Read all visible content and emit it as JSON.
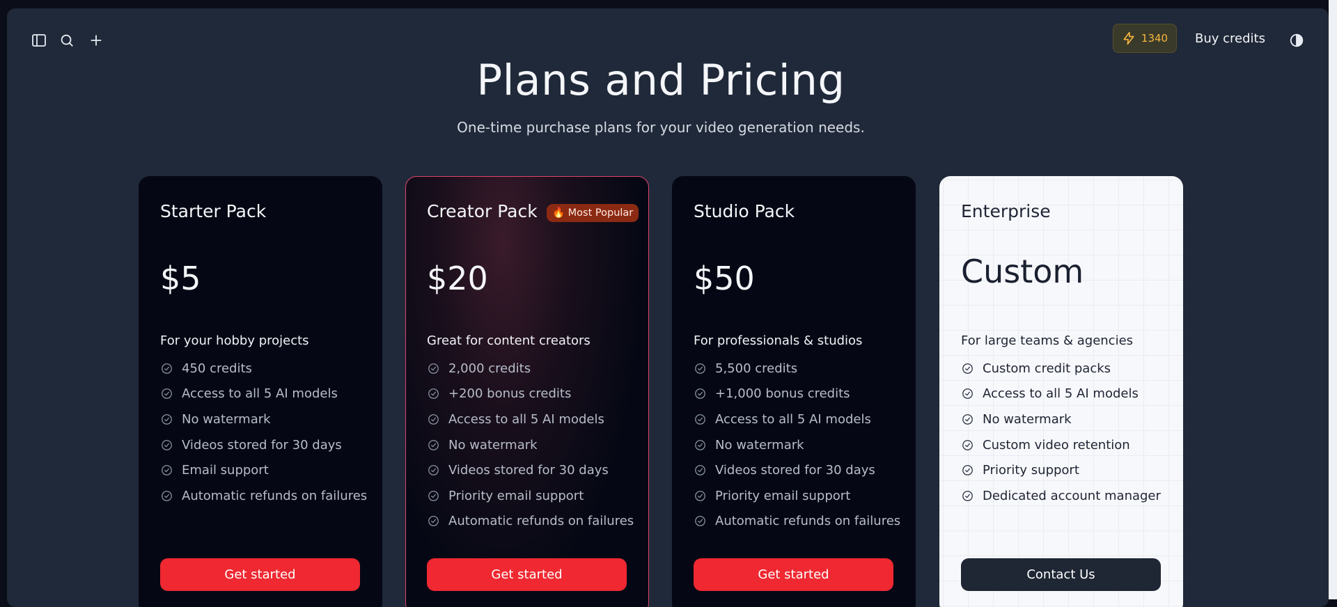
{
  "topbar": {
    "credits": "1340",
    "buy_credits_label": "Buy credits"
  },
  "header": {
    "title": "Plans and Pricing",
    "subtitle": "One-time purchase plans for your video generation needs."
  },
  "plans": [
    {
      "name": "Starter Pack",
      "price": "$5",
      "description": "For your hobby projects",
      "features": [
        "450 credits",
        "Access to all 5 AI models",
        "No watermark",
        "Videos stored for 30 days",
        "Email support",
        "Automatic refunds on failures"
      ],
      "cta": "Get started"
    },
    {
      "name": "Creator Pack",
      "badge": "🔥 Most Popular",
      "price": "$20",
      "description": "Great for content creators",
      "features": [
        "2,000 credits",
        "+200 bonus credits",
        "Access to all 5 AI models",
        "No watermark",
        "Videos stored for 30 days",
        "Priority email support",
        "Automatic refunds on failures"
      ],
      "cta": "Get started"
    },
    {
      "name": "Studio Pack",
      "price": "$50",
      "description": "For professionals & studios",
      "features": [
        "5,500 credits",
        "+1,000 bonus credits",
        "Access to all 5 AI models",
        "No watermark",
        "Videos stored for 30 days",
        "Priority email support",
        "Automatic refunds on failures"
      ],
      "cta": "Get started"
    },
    {
      "name": "Enterprise",
      "price": "Custom",
      "description": "For large teams & agencies",
      "features": [
        "Custom credit packs",
        "Access to all 5 AI models",
        "No watermark",
        "Custom video retention",
        "Priority support",
        "Dedicated account manager"
      ],
      "cta": "Contact Us"
    }
  ],
  "colors": {
    "accent": "#ef2831",
    "credits_text": "#f4b53f",
    "popular_border": "#e0446f",
    "background": "#202939"
  },
  "icons": [
    "sidebar-toggle-icon",
    "search-icon",
    "plus-icon",
    "lightning-icon",
    "contrast-icon",
    "check-circle-icon"
  ]
}
